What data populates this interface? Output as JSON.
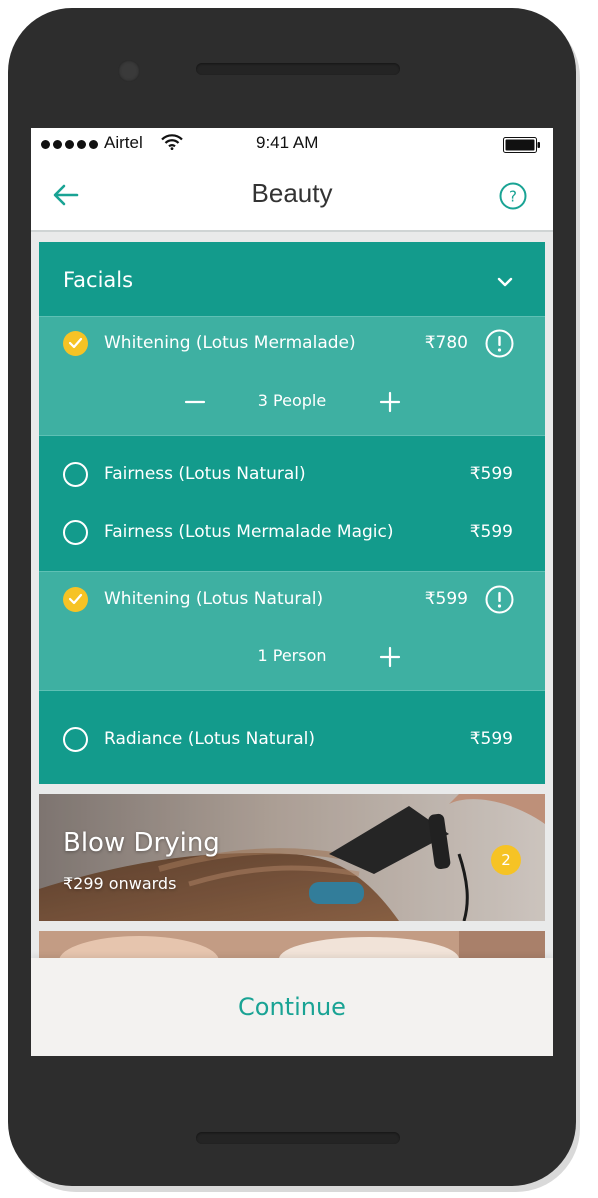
{
  "status_bar": {
    "carrier": "Airtel",
    "time": "9:41 AM",
    "icons": [
      "signal-dots-icon",
      "wifi-icon",
      "battery-icon"
    ]
  },
  "header": {
    "title": "Beauty",
    "back_icon": "arrow-left-icon",
    "help_icon": "question-circle-icon"
  },
  "facials": {
    "title": "Facials",
    "expanded": true,
    "items": [
      {
        "name": "Whitening (Lotus Mermalade)",
        "price": "₹780",
        "selected": true,
        "quantity": "3 People",
        "has_minus": true
      },
      {
        "name": "Fairness (Lotus Natural)",
        "price": "₹599",
        "selected": false
      },
      {
        "name": "Fairness (Lotus Mermalade Magic)",
        "price": "₹599",
        "selected": false
      },
      {
        "name": "Whitening (Lotus Natural)",
        "price": "₹599",
        "selected": true,
        "quantity": "1 Person",
        "has_minus": false
      },
      {
        "name": "Radiance (Lotus Natural)",
        "price": "₹599",
        "selected": false
      }
    ]
  },
  "blow_drying": {
    "title": "Blow Drying",
    "subtitle": "₹299 onwards",
    "badge": "2"
  },
  "footer": {
    "continue_label": "Continue"
  },
  "colors": {
    "teal": "#139b8c",
    "teal_selected": "#3eb0a2",
    "accent_yellow": "#f6c325",
    "continue_text": "#19a394",
    "phone_body": "#2d2d2d"
  }
}
